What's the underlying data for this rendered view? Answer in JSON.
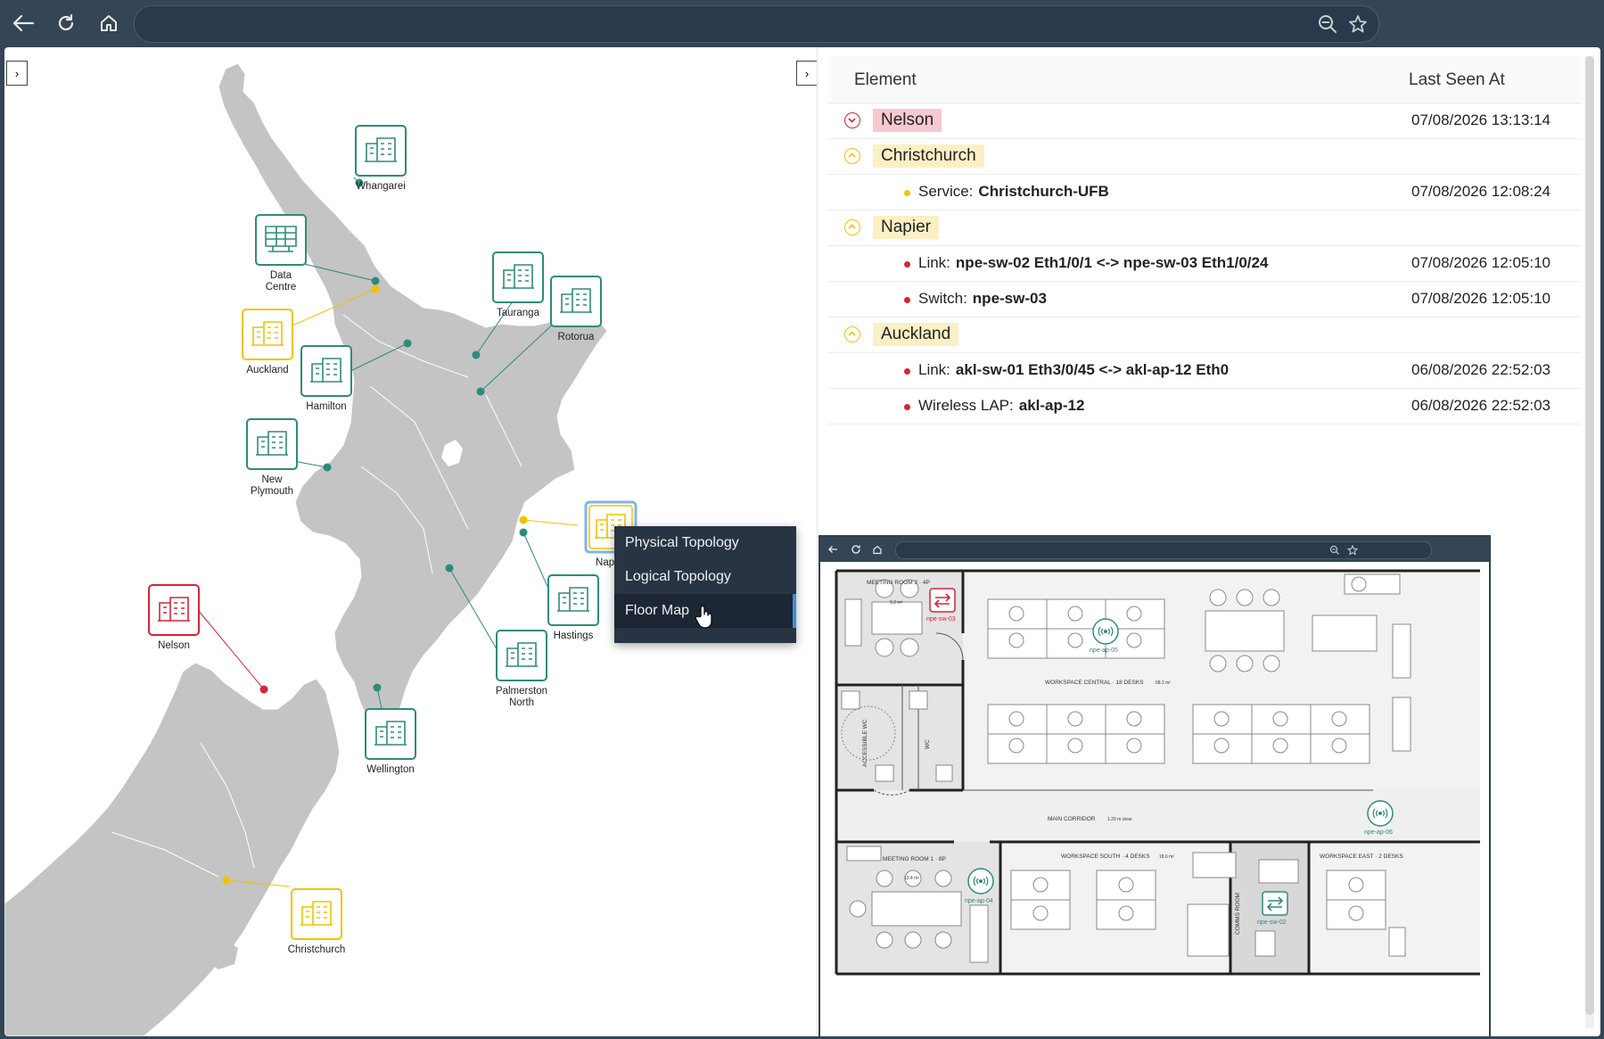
{
  "browser": {
    "nav": {
      "back_icon": "arrow-left-icon",
      "refresh_icon": "refresh-icon",
      "home_icon": "home-icon"
    },
    "url": {
      "value": "",
      "zoom_icon": "zoom-out-icon",
      "bookmark_icon": "star-icon"
    }
  },
  "map": {
    "sites": [
      {
        "name": "Whangarei",
        "status": "ok"
      },
      {
        "name": "Data\nCentre",
        "status": "ok"
      },
      {
        "name": "Auckland",
        "status": "warning"
      },
      {
        "name": "Tauranga",
        "status": "ok"
      },
      {
        "name": "Rotorua",
        "status": "ok"
      },
      {
        "name": "Hamilton",
        "status": "ok"
      },
      {
        "name": "New\nPlymouth",
        "status": "ok"
      },
      {
        "name": "Napier",
        "status": "warning"
      },
      {
        "name": "Hastings",
        "status": "ok"
      },
      {
        "name": "Nelson",
        "status": "critical"
      },
      {
        "name": "Palmerston\nNorth",
        "status": "ok"
      },
      {
        "name": "Wellington",
        "status": "ok"
      },
      {
        "name": "Christchurch",
        "status": "warning"
      }
    ],
    "context_menu": {
      "items": [
        "Physical Topology",
        "Logical Topology",
        "Floor Map"
      ],
      "active_index": 2
    }
  },
  "colors": {
    "ok": "#2e8b7a",
    "warning": "#f2c200",
    "critical": "#d6243a",
    "land": "#c4c4c4",
    "menu_bg": "#283444"
  },
  "table": {
    "columns": [
      "Element",
      "Last Seen At"
    ],
    "rows": [
      {
        "kind": "group",
        "label": "Nelson",
        "status": "critical",
        "time": "07/08/2026 13:13:14"
      },
      {
        "kind": "group",
        "label": "Christchurch",
        "status": "warning",
        "time": ""
      },
      {
        "kind": "child",
        "status": "warning",
        "type": "Service:",
        "value": "Christchurch-UFB",
        "time": "07/08/2026 12:08:24"
      },
      {
        "kind": "group",
        "label": "Napier",
        "status": "warning",
        "time": ""
      },
      {
        "kind": "child",
        "status": "critical",
        "type": "Link:",
        "value": "npe-sw-02 Eth1/0/1 <-> npe-sw-03 Eth1/0/24",
        "time": "07/08/2026 12:05:10"
      },
      {
        "kind": "child",
        "status": "critical",
        "type": "Switch:",
        "value": "npe-sw-03",
        "time": "07/08/2026 12:05:10"
      },
      {
        "kind": "group",
        "label": "Auckland",
        "status": "warning",
        "time": ""
      },
      {
        "kind": "child",
        "status": "critical",
        "type": "Link:",
        "value": "akl-sw-01 Eth3/0/45 <-> akl-ap-12 Eth0",
        "time": "06/08/2026 22:52:03"
      },
      {
        "kind": "child",
        "status": "critical",
        "type": "Wireless LAP:",
        "value": "akl-ap-12",
        "time": "06/08/2026 22:52:03"
      }
    ]
  },
  "floor_map": {
    "rooms": [
      "MEETING ROOM 2 · 4P",
      "WORKSPACE CENTRAL · 18 DESKS",
      "ACCESSIBLE WC",
      "WC",
      "MAIN CORRIDOR",
      "MEETING ROOM 1 · 8P",
      "WORKSPACE SOUTH · 4 DESKS",
      "COMMS ROOM",
      "WORKSPACE EAST · 2 DESKS"
    ],
    "areas": [
      "9.3 m²",
      "68.2 m²",
      "1.20 m clear",
      "13.4 m²",
      "18.6 m²"
    ],
    "devices": [
      {
        "name": "npe-sw-03",
        "type": "switch",
        "status": "critical"
      },
      {
        "name": "npe-ap-05",
        "type": "ap",
        "status": "ok"
      },
      {
        "name": "npe-ap-06",
        "type": "ap",
        "status": "ok"
      },
      {
        "name": "npe-ap-04",
        "type": "ap",
        "status": "ok"
      },
      {
        "name": "npe-sw-02",
        "type": "switch",
        "status": "ok"
      }
    ]
  }
}
